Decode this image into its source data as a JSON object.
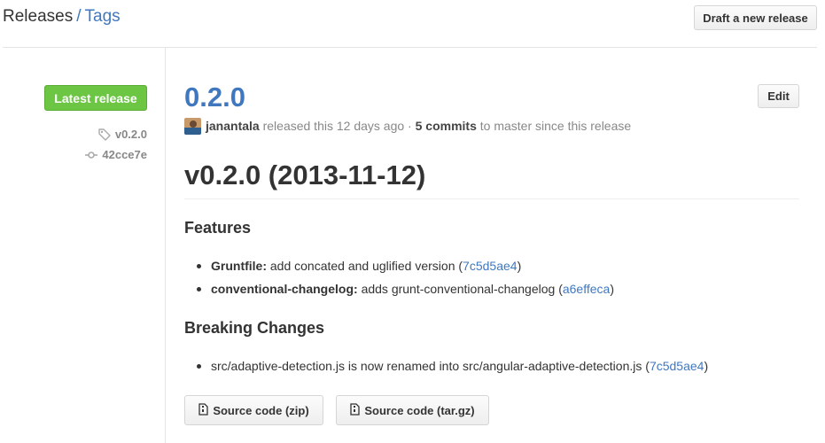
{
  "header": {
    "releases_label": "Releases",
    "separator": "/",
    "tags_label": "Tags",
    "draft_button": "Draft a new release"
  },
  "sidebar": {
    "badge": "Latest release",
    "tag": "v0.2.0",
    "commit": "42cce7e"
  },
  "release": {
    "title": "0.2.0",
    "edit_button": "Edit",
    "author": "janantala",
    "released_text": "released this 12 days ago",
    "dot": "·",
    "commits": "5 commits",
    "since_text": "to master since this release",
    "body_title": "v0.2.0 (2013-11-12)",
    "features_heading": "Features",
    "features": [
      {
        "label": "Gruntfile:",
        "text": "add concated and uglified version",
        "open": "(",
        "hash": "7c5d5ae4",
        "close": ")"
      },
      {
        "label": "conventional-changelog:",
        "text": "adds grunt-conventional-changelog",
        "open": "(",
        "hash": "a6effeca",
        "close": ")"
      }
    ],
    "breaking_heading": "Breaking Changes",
    "breaking": [
      {
        "text": "src/adaptive-detection.js is now renamed into src/angular-adaptive-detection.js",
        "open": "(",
        "hash": "7c5d5ae4",
        "close": ")"
      }
    ],
    "download_zip": "Source code (zip)",
    "download_tgz": "Source code (tar.gz)"
  },
  "colors": {
    "link": "#4078c0",
    "badge_green": "#6cc644",
    "muted": "#888888"
  },
  "icons": [
    "tag-icon",
    "commit-icon",
    "file-zip-icon"
  ]
}
